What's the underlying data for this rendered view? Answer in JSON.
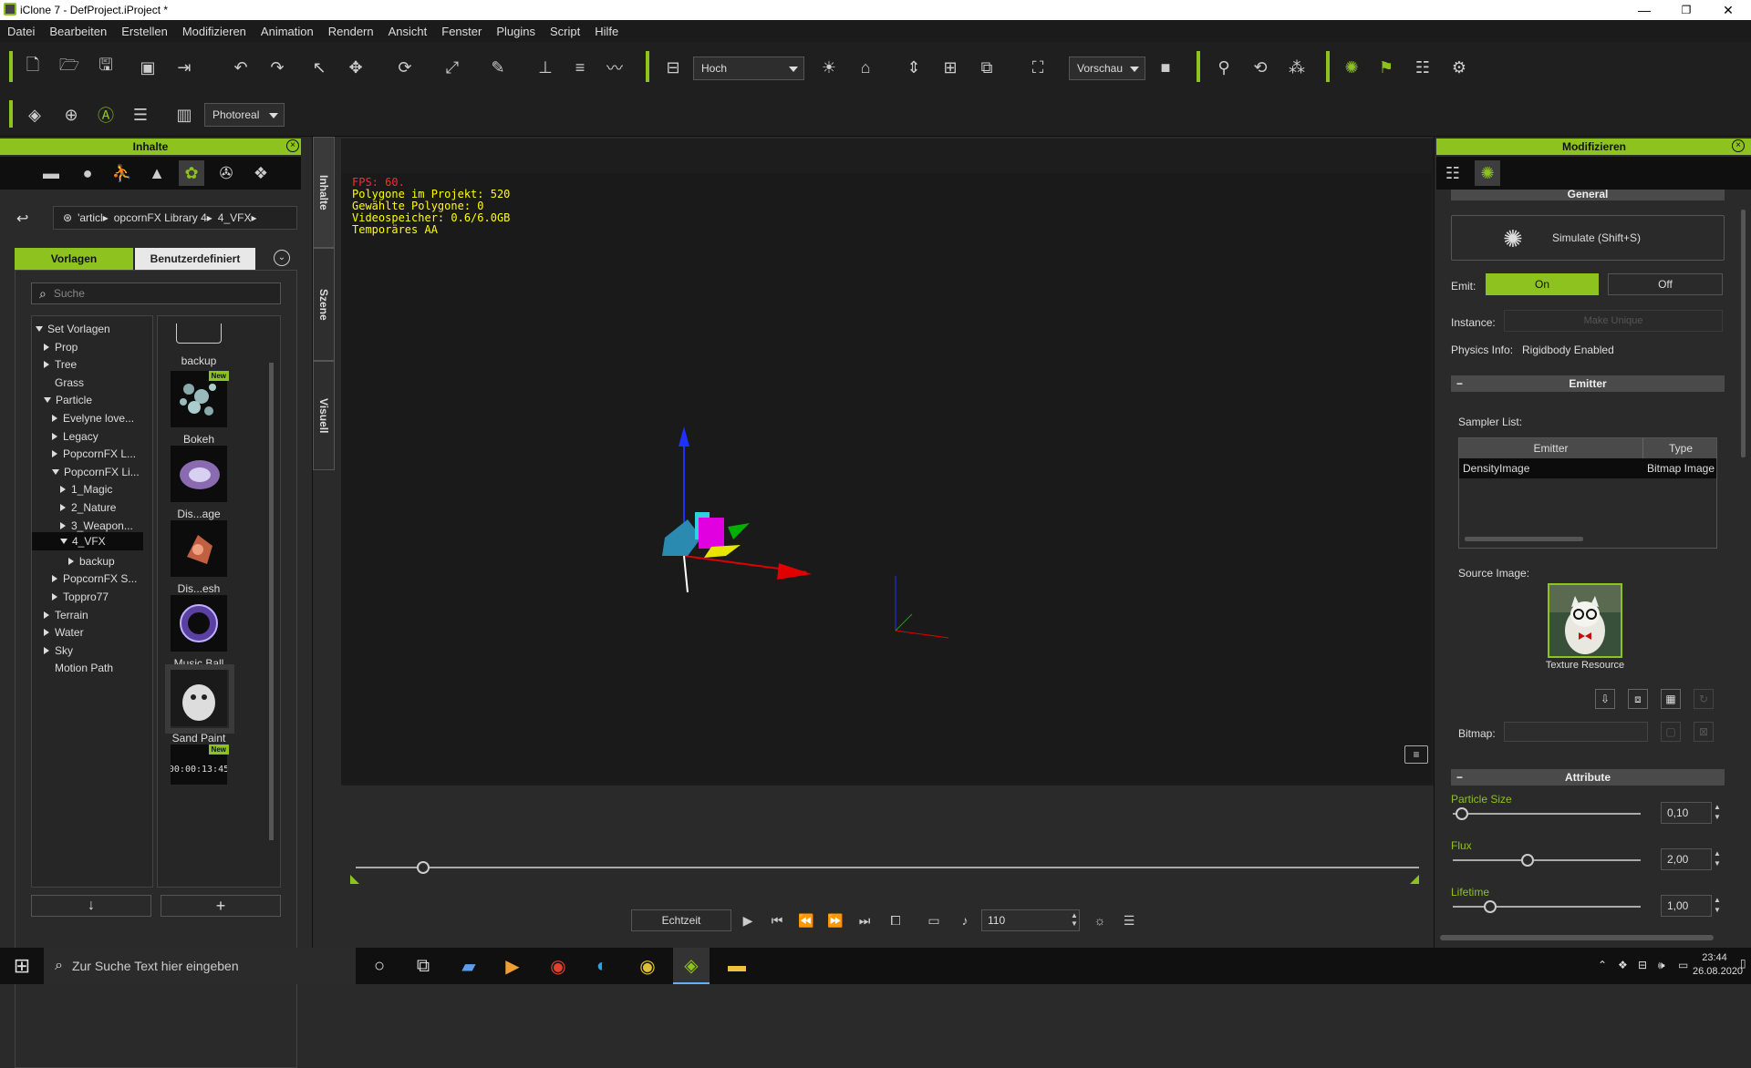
{
  "window": {
    "title": "iClone 7 - DefProject.iProject *",
    "minimize": "—",
    "maximize": "❐",
    "close": "✕"
  },
  "menu": [
    "Datei",
    "Bearbeiten",
    "Erstellen",
    "Modifizieren",
    "Animation",
    "Rendern",
    "Ansicht",
    "Fenster",
    "Plugins",
    "Script",
    "Hilfe"
  ],
  "toolbar": {
    "view_mode": "Hoch",
    "preview_mode": "Vorschau",
    "render_mode": "Photoreal"
  },
  "content_panel": {
    "title": "Inhalte",
    "breadcrumb": [
      "'articl▸",
      "opcornFX Library 4▸",
      "4_VFX▸"
    ],
    "tabs": {
      "templates": "Vorlagen",
      "custom": "Benutzerdefiniert"
    },
    "search_placeholder": "Suche",
    "tree": [
      {
        "label": "Set Vorlagen",
        "level": 0,
        "state": "open"
      },
      {
        "label": "Prop",
        "level": 1,
        "state": "closed"
      },
      {
        "label": "Tree",
        "level": 1,
        "state": "closed"
      },
      {
        "label": "Grass",
        "level": 1,
        "state": "none"
      },
      {
        "label": "Particle",
        "level": 1,
        "state": "open"
      },
      {
        "label": "Evelyne love...",
        "level": 2,
        "state": "closed"
      },
      {
        "label": "Legacy",
        "level": 2,
        "state": "closed"
      },
      {
        "label": "PopcornFX L...",
        "level": 2,
        "state": "closed"
      },
      {
        "label": "PopcornFX Li...",
        "level": 2,
        "state": "open"
      },
      {
        "label": "1_Magic",
        "level": 3,
        "state": "closed"
      },
      {
        "label": "2_Nature",
        "level": 3,
        "state": "closed"
      },
      {
        "label": "3_Weapon...",
        "level": 3,
        "state": "closed"
      },
      {
        "label": "4_VFX",
        "level": 3,
        "state": "open",
        "selected": true
      },
      {
        "label": "backup",
        "level": 4,
        "state": "closed"
      },
      {
        "label": "PopcornFX S...",
        "level": 2,
        "state": "closed"
      },
      {
        "label": "Toppro77",
        "level": 2,
        "state": "closed"
      },
      {
        "label": "Terrain",
        "level": 1,
        "state": "closed"
      },
      {
        "label": "Water",
        "level": 1,
        "state": "closed"
      },
      {
        "label": "Sky",
        "level": 1,
        "state": "closed"
      },
      {
        "label": "Motion Path",
        "level": 1,
        "state": "none"
      }
    ],
    "items": [
      {
        "label": "backup",
        "kind": "folder"
      },
      {
        "label": "Bokeh",
        "kind": "bokeh",
        "badge": "New"
      },
      {
        "label": "Dis...age",
        "kind": "disage"
      },
      {
        "label": "Dis...esh",
        "kind": "dismesh"
      },
      {
        "label": "Music Ball",
        "kind": "ball"
      },
      {
        "label": "Sand Paint",
        "kind": "sand"
      },
      {
        "label": "",
        "kind": "clock",
        "badge": "New",
        "clock_text": "00:00:13:45"
      }
    ]
  },
  "side_tabs": [
    "Inhalte",
    "Szene",
    "Visuell"
  ],
  "viewport": {
    "stats": {
      "fps": "FPS: 60.",
      "poly_project": "Polygone im Projekt: 520",
      "poly_selected": "Gewählte Polygone: 0",
      "video_mem": "Videospeicher: 0.6/6.0GB",
      "temporal": "Temporäres AA"
    }
  },
  "playback": {
    "mode": "Echtzeit",
    "frame": "110"
  },
  "modify_panel": {
    "title": "Modifizieren",
    "general": "General",
    "simulate": "Simulate (Shift+S)",
    "emit_label": "Emit:",
    "emit_on": "On",
    "emit_off": "Off",
    "instance_label": "Instance:",
    "make_unique": "Make Unique",
    "physics_label": "Physics Info:",
    "physics_value": "Rigidbody Enabled",
    "emitter_section": "Emitter",
    "sampler_list": "Sampler List:",
    "table_headers": [
      "Emitter",
      "Type"
    ],
    "table_rows": [
      [
        "DensityImage",
        "Bitmap Image"
      ]
    ],
    "source_image": "Source Image:",
    "texture_resource": "Texture Resource",
    "bitmap_label": "Bitmap:",
    "attribute_section": "Attribute",
    "attributes": [
      {
        "label": "Particle Size",
        "value": "0,10",
        "fraction": 0.05
      },
      {
        "label": "Flux",
        "value": "2,00",
        "fraction": 0.4
      },
      {
        "label": "Lifetime",
        "value": "1,00",
        "fraction": 0.2
      }
    ]
  },
  "taskbar": {
    "search_placeholder": "Zur Suche Text hier eingeben",
    "time": "23:44",
    "date": "26.08.2020"
  },
  "colors": {
    "accent": "#8dc21f",
    "stats_fps": "#ff2a2a",
    "stats_text": "#ffff00"
  }
}
